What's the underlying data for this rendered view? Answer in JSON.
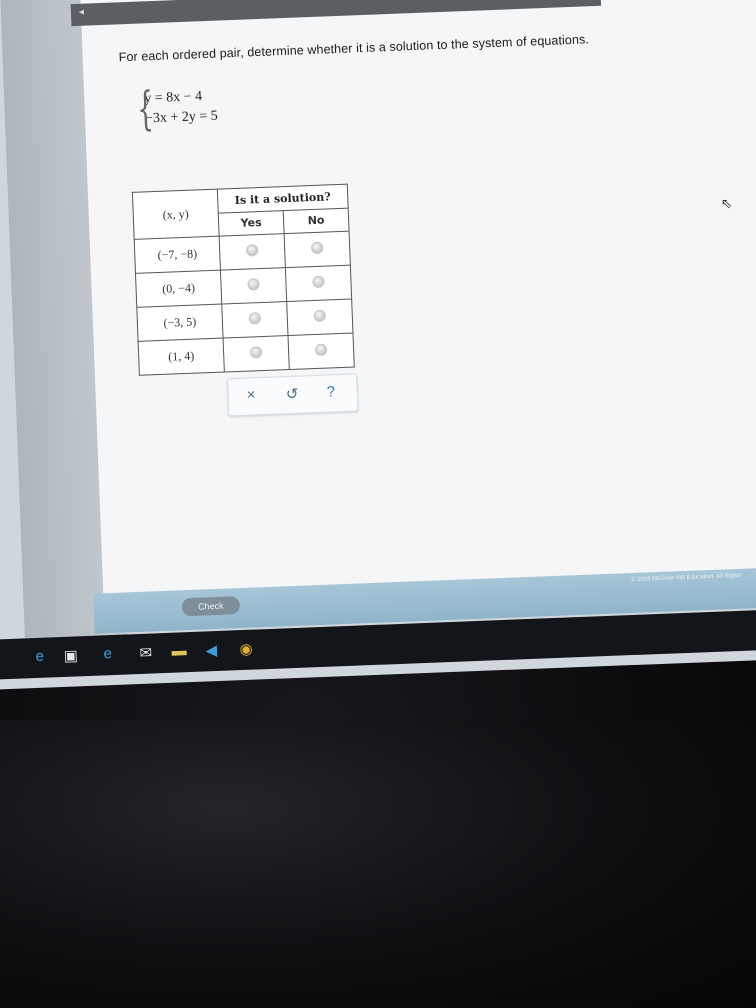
{
  "prompt": "For each ordered pair, determine whether it is a solution to the system of equations.",
  "system": {
    "equations": [
      "y = 8x − 4",
      "−3x + 2y = 5"
    ]
  },
  "table": {
    "header_xy": "(x, y)",
    "header_solution": "Is it a solution?",
    "col_yes": "Yes",
    "col_no": "No",
    "rows": [
      {
        "pair": "(−7, −8)",
        "yes": false,
        "no": false
      },
      {
        "pair": "(0, −4)",
        "yes": false,
        "no": false
      },
      {
        "pair": "(−3, 5)",
        "yes": false,
        "no": false
      },
      {
        "pair": "(1, 4)",
        "yes": false,
        "no": false
      }
    ]
  },
  "actions": {
    "clear": "×",
    "undo": "↺",
    "help": "?"
  },
  "footer": {
    "check_label": "Check",
    "copyright": "© 2019 McGraw-Hill Education. All Rights"
  },
  "taskbar": {
    "icons": [
      "edge-icon",
      "store-icon",
      "ie-icon",
      "mail-icon",
      "files-icon",
      "media-icon",
      "chrome-icon"
    ]
  },
  "colors": {
    "top_strip": "#5b5f63",
    "top_buttons": [
      "#c33a2b",
      "#41a95f",
      "#3a3a3a",
      "#41a95f",
      "#41a95f"
    ],
    "footer_band": "#8fb4c9",
    "check_button": "#7e8f9a"
  }
}
